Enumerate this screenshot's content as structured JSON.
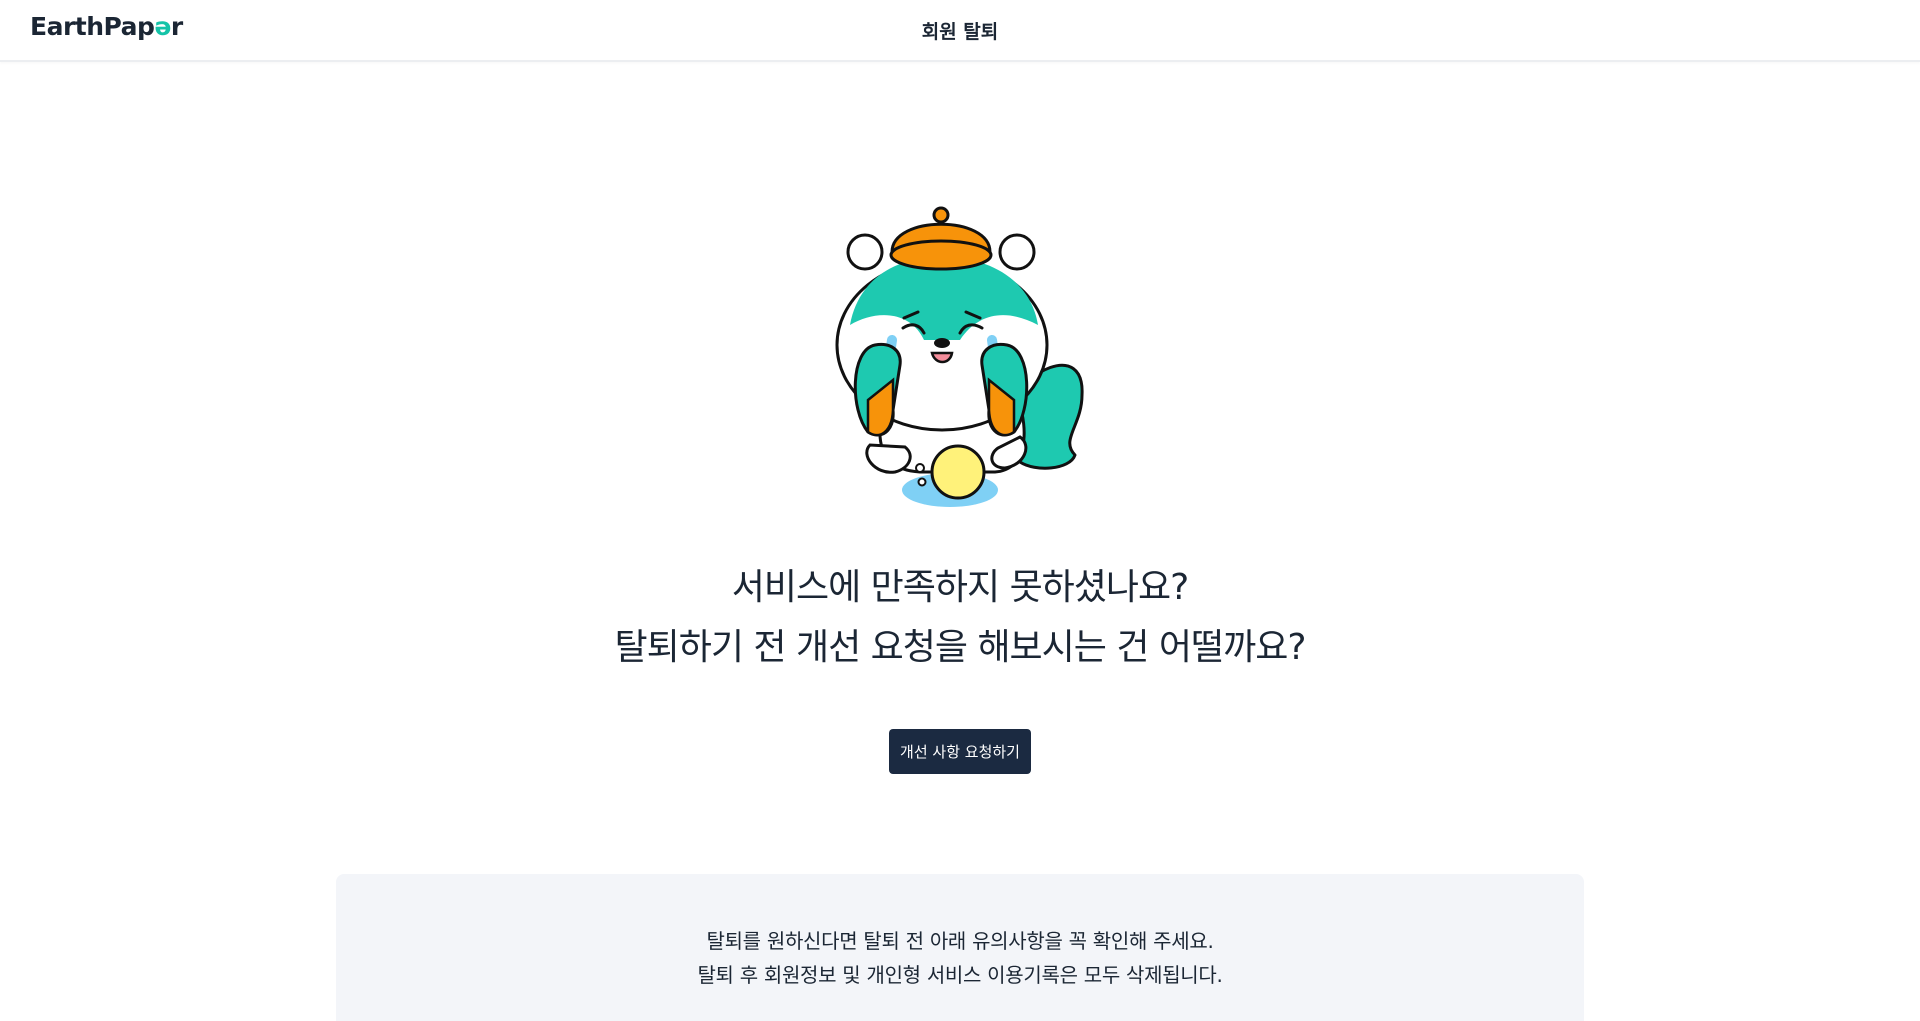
{
  "header": {
    "logo_main": "EarthPap",
    "logo_accent": "ə",
    "logo_tail": "r",
    "title": "회원 탈퇴"
  },
  "hero": {
    "line1": "서비스에 만족하지 못하셨나요?",
    "line2": "탈퇴하기 전 개선 요청을 해보시는 건 어떨까요?",
    "button_label": "개선 사항 요청하기"
  },
  "notice": {
    "line1": "탈퇴를 원하신다면 탈퇴 전 아래 유의사항을 꼭 확인해 주세요.",
    "line2": "탈퇴 후 회원정보 및 개인형 서비스 이용기록은 모두 삭제됩니다."
  },
  "colors": {
    "brand_teal": "#14c3a8",
    "brand_navy": "#1b2a41",
    "mascot_orange": "#f7930a",
    "notice_bg": "#f3f5f9"
  },
  "icons": {
    "mascot": "crying-squirrel-mascot-illustration"
  }
}
